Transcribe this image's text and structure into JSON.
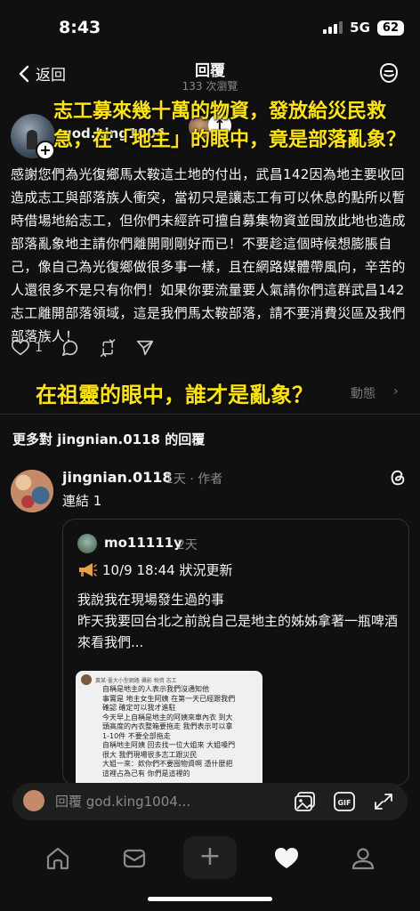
{
  "status_bar": {
    "time": "8:43",
    "network": "5G",
    "battery": "62"
  },
  "header": {
    "back_label": "返回",
    "title": "回覆",
    "views": "133 次瀏覽",
    "activity_icon": "threads-activity-icon"
  },
  "post": {
    "username": "god.king1004",
    "overlay_title": "志工募來幾十萬的物資，發放給災民救急，在「地主」的眼中，竟是部落亂象？",
    "text": "感謝您們為光復鄉馬太鞍這土地的付出，武昌142因為地主要收回造成志工與部落族人衝突，當初只是讓志工有可以休息的點所以暫時借場地給志工，但你們未經許可擅自募集物資並囤放此地也造成部落亂象地主請你們離開剛剛好而已！不要趁這個時候想膨脹自己，像自己為光復鄉做很多事一樣，且在網路媒體帶風向，辛苦的人還很多不是只有你們！如果你要流量要人氣請你們這群武昌142志工離開部落領域，這是我們馬太鞍部落，請不要消費災區及我們部落族人！",
    "like_count": "1",
    "overlay_bottom": "在祖靈的眼中，誰才是亂象？",
    "related_label": "動態"
  },
  "more_heading": "更多對 jingnian.0118 的回覆",
  "reply": {
    "username": "jingnian.0118",
    "meta": "1天 · 作者",
    "text": "連結 1",
    "quote": {
      "username": "mo11111y",
      "time": "2天",
      "line1": "10/9 18:44 狀況更新",
      "body": "我說我在現場發生過的事\n昨天我要回台北之前說自己是地主的姊姊拿著一瓶啤酒來看我們...",
      "image_name": "黃某‧臺大小型網路 攝影 物資 志工",
      "image_text": "自稱是地主的人表示我們沒通知他\n事實是 地主女生阿姨 在第一天已經跟我們確認 確定可以我才進駐\n今天早上自稱是地主的阿姨來車內衣 到大頭高度的內衣整箱要拖走 我們表示可以拿1-10件 不要全部拖走\n自稱地主阿姨 回去找一位大姐來 大姐嗓門很大 我們現場很多志工跟災民\n大姐一來：欸你們不要囤物資啊 憑什麼把這裡占為己有 你們是這裡的"
    }
  },
  "composer": {
    "placeholder": "回覆 god.king1004..."
  }
}
